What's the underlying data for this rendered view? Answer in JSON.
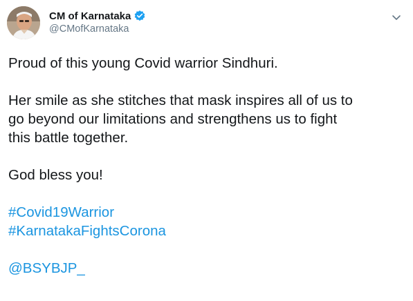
{
  "author": {
    "display_name": "CM of Karnataka",
    "handle": "@CMofKarnataka",
    "verified": true,
    "avatar_icon": "profile-photo"
  },
  "tweet": {
    "line1": "Proud of this young Covid warrior Sindhuri.",
    "line2": "Her smile as she stitches that mask inspires all of us to",
    "line3": "go beyond our limitations and strengthens us to fight",
    "line4": "this battle together.",
    "line5": "God bless you!",
    "hashtags": [
      "#Covid19Warrior",
      "#KarnatakaFightsCorona"
    ],
    "mention": "@BSYBJP_"
  },
  "colors": {
    "link": "#1b95e0",
    "verified_badge": "#1da1f2",
    "secondary_text": "#657786",
    "primary_text": "#14171a"
  },
  "icons": {
    "menu": "chevron-down-icon",
    "verified": "verified-badge-icon"
  }
}
